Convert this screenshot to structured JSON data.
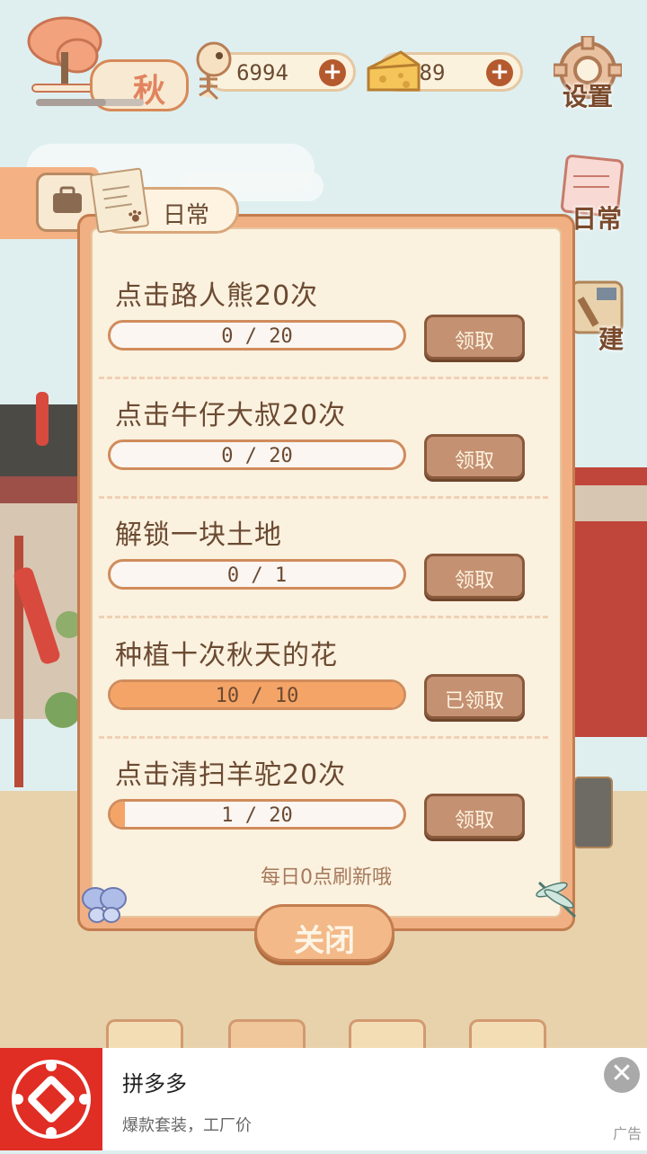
{
  "hud": {
    "season_label": "秋",
    "fish_count": "6994",
    "cheese_count": "89",
    "settings_label": "设置"
  },
  "side_buttons": {
    "daily_label": "日常",
    "build_label": "建"
  },
  "dialog": {
    "tab_title": "日常",
    "tasks": [
      {
        "title": "点击路人熊20次",
        "progress_text": "0 / 20",
        "progress": 0.0,
        "button": "领取"
      },
      {
        "title": "点击牛仔大叔20次",
        "progress_text": "0 / 20",
        "progress": 0.0,
        "button": "领取"
      },
      {
        "title": "解锁一块土地",
        "progress_text": "0 / 1",
        "progress": 0.0,
        "button": "领取"
      },
      {
        "title": "种植十次秋天的花",
        "progress_text": "10 / 10",
        "progress": 1.0,
        "button": "已领取"
      },
      {
        "title": "点击清扫羊驼20次",
        "progress_text": "1 / 20",
        "progress": 0.05,
        "button": "领取"
      }
    ],
    "refresh_note": "每日0点刷新哦",
    "close_label": "关闭"
  },
  "ad": {
    "title": "拼多多",
    "description": "爆款套装，工厂价",
    "tag": "广告",
    "close_glyph": "✕",
    "brand_color": "#e02e24"
  }
}
